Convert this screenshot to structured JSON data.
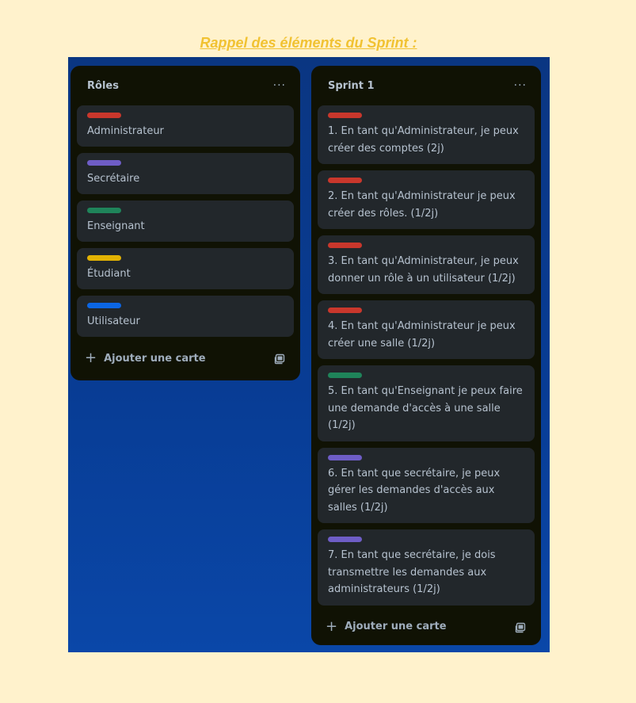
{
  "page": {
    "heading": "Rappel des éléments du Sprint :"
  },
  "lists": [
    {
      "title": "Rôles",
      "menu_icon": "ellipsis-icon",
      "cards": [
        {
          "label_color": "#c9372c",
          "text": "Administrateur"
        },
        {
          "label_color": "#6e5dc6",
          "text": "Secrétaire"
        },
        {
          "label_color": "#1f845a",
          "text": "Enseignant"
        },
        {
          "label_color": "#e2b203",
          "text": "Étudiant"
        },
        {
          "label_color": "#0c66e4",
          "text": "Utilisateur"
        }
      ],
      "add_card_label": "Ajouter une carte",
      "template_icon": "card-template-icon"
    },
    {
      "title": "Sprint 1",
      "menu_icon": "ellipsis-icon",
      "cards": [
        {
          "label_color": "#c9372c",
          "text": "1. En tant qu'Administrateur, je peux créer des comptes (2j)"
        },
        {
          "label_color": "#c9372c",
          "text": "2. En tant qu'Administrateur je peux créer des rôles. (1/2j)"
        },
        {
          "label_color": "#c9372c",
          "text": "3. En tant qu'Administrateur, je peux donner un rôle à un utilisateur (1/2j)"
        },
        {
          "label_color": "#c9372c",
          "text": "4. En tant qu'Administrateur je peux créer une salle (1/2j)"
        },
        {
          "label_color": "#1f845a",
          "text": "5. En tant qu'Enseignant je peux faire une demande d'accès à une salle (1/2j)"
        },
        {
          "label_color": "#6e5dc6",
          "text": "6. En tant que secrétaire, je peux gérer les demandes d'accès aux salles (1/2j)"
        },
        {
          "label_color": "#6e5dc6",
          "text": "7. En tant que secrétaire, je dois transmettre les demandes aux administrateurs (1/2j)"
        }
      ],
      "add_card_label": "Ajouter une carte",
      "template_icon": "card-template-icon"
    }
  ],
  "colors": {
    "page_background": "#fff2cc",
    "heading": "#f1c232",
    "board_background": "#0a3d96",
    "list_background": "#101204",
    "card_background": "#22272b",
    "text": "#b6c2cf"
  }
}
